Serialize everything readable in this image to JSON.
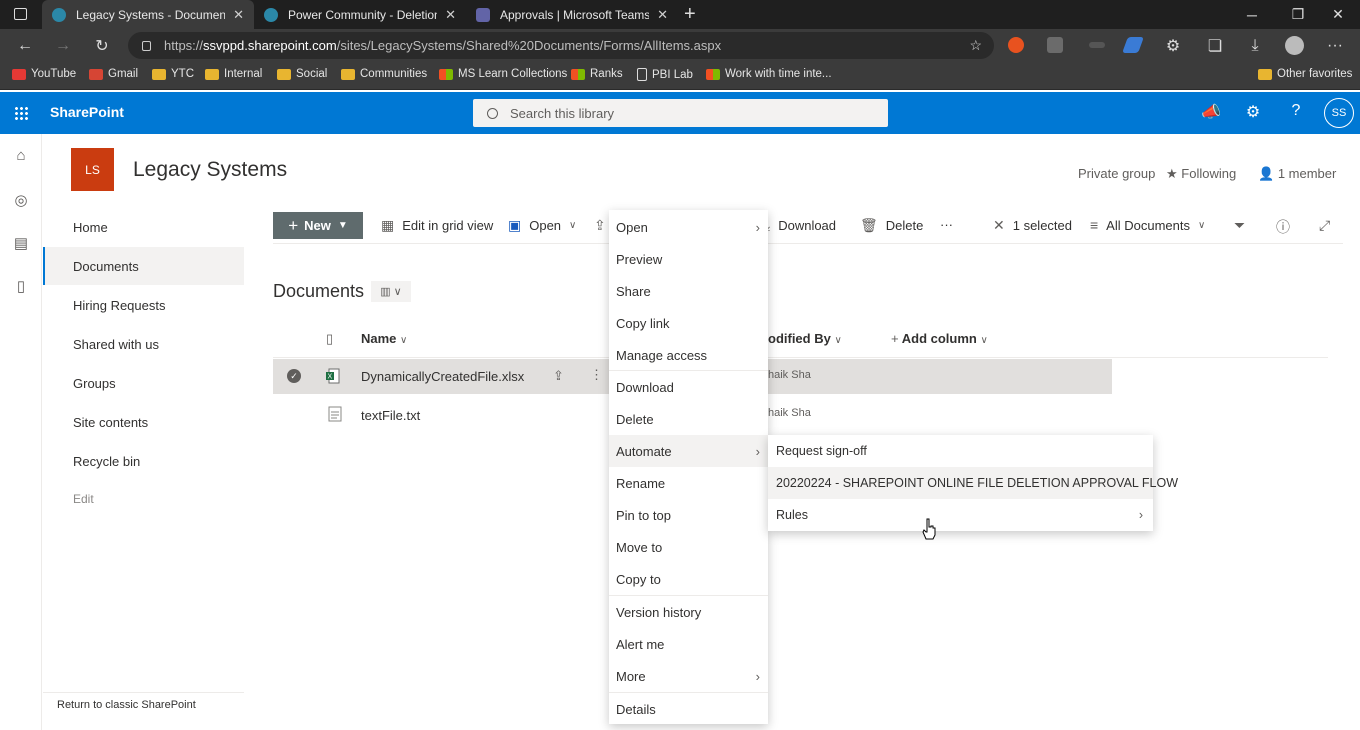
{
  "browser": {
    "tabs": [
      {
        "label": "Legacy Systems - Documents - All",
        "active": true
      },
      {
        "label": "Power Community - Deletion Re",
        "active": false
      },
      {
        "label": "Approvals | Microsoft Teams",
        "active": false
      }
    ],
    "url_prefix": "https://",
    "url_host": "ssvppd.sharepoint.com",
    "url_path": "/sites/LegacySystems/Shared%20Documents/Forms/AllItems.aspx",
    "favorites": [
      "YouTube",
      "Gmail",
      "YTC",
      "Internal",
      "Social",
      "Communities",
      "MS Learn Collections",
      "Ranks",
      "PBI Lab",
      "Work with time inte..."
    ],
    "other_favorites": "Other favorites"
  },
  "suite": {
    "app_name": "SharePoint",
    "search_placeholder": "Search this library",
    "avatar_initials": "SS"
  },
  "site": {
    "logo": "LS",
    "name": "Legacy Systems",
    "privacy": "Private group",
    "following": "Following",
    "members": "1 member"
  },
  "nav": {
    "items": [
      "Home",
      "Documents",
      "Hiring Requests",
      "Shared with us",
      "Groups",
      "Site contents",
      "Recycle bin"
    ],
    "edit": "Edit",
    "classic_link": "Return to classic SharePoint"
  },
  "commands": {
    "new": "New",
    "grid_view": "Edit in grid view",
    "open": "Open",
    "download": "Download",
    "delete": "Delete",
    "more": "···",
    "selected": "1 selected",
    "view": "All Documents"
  },
  "library": {
    "title": "Documents",
    "columns": {
      "name": "Name",
      "modified_by": "odified By",
      "add_column": "Add column"
    },
    "files": [
      {
        "name": "DynamicallyCreatedFile.xlsx",
        "modified_by": "haik Sha",
        "selected": true
      },
      {
        "name": "textFile.txt",
        "modified_by": "haik Sha",
        "selected": false
      }
    ]
  },
  "context_menu": {
    "items": [
      "Open",
      "Preview",
      "Share",
      "Copy link",
      "Manage access",
      "Download",
      "Delete",
      "Automate",
      "Rename",
      "Pin to top",
      "Move to",
      "Copy to",
      "Version history",
      "Alert me",
      "More",
      "Details"
    ],
    "highlighted": "Automate"
  },
  "automate_submenu": {
    "items": [
      "Request sign-off",
      "20220224 - SHAREPOINT ONLINE FILE DELETION APPROVAL FLOW",
      "Rules"
    ]
  },
  "colors": {
    "suite_blue": "#0078d4",
    "site_logo": "#ca3c10",
    "new_button": "#5f6b6d"
  }
}
